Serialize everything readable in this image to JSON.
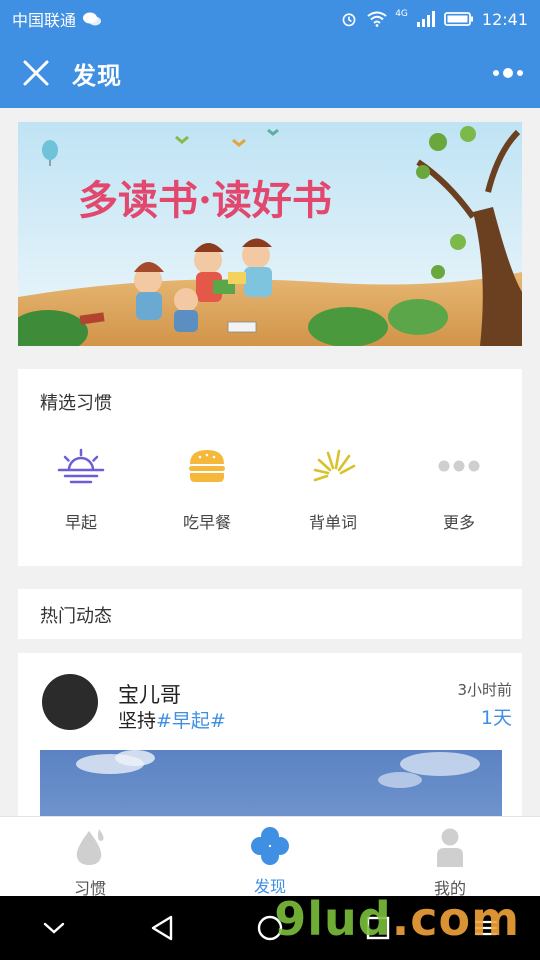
{
  "status_bar": {
    "carrier": "中国联通",
    "signal": "4G",
    "time": "12:41"
  },
  "app_bar": {
    "title": "发现"
  },
  "banner": {
    "text": "多读书·读好书"
  },
  "habits": {
    "title": "精选习惯",
    "items": [
      {
        "label": "早起",
        "icon": "sunrise-icon",
        "color": "#6b5fd6"
      },
      {
        "label": "吃早餐",
        "icon": "burger-icon",
        "color": "#f5b83a"
      },
      {
        "label": "背单词",
        "icon": "rays-icon",
        "color": "#d8c22a"
      },
      {
        "label": "更多",
        "icon": "more-dots-icon",
        "color": "#cfcfcf"
      }
    ]
  },
  "hot": {
    "title": "热门动态"
  },
  "post": {
    "user": "宝儿哥",
    "text_prefix": "坚持",
    "tag": "#早起#",
    "time": "3小时前",
    "days": "1天"
  },
  "tabs": [
    {
      "label": "习惯",
      "icon": "drop-icon",
      "active": false
    },
    {
      "label": "发现",
      "icon": "clover-icon",
      "active": true
    },
    {
      "label": "我的",
      "icon": "person-icon",
      "active": false
    }
  ],
  "watermark": {
    "text": "9lud",
    "suffix": ".com"
  },
  "colors": {
    "primary": "#3f8fe3",
    "background": "#f1f1f1"
  }
}
